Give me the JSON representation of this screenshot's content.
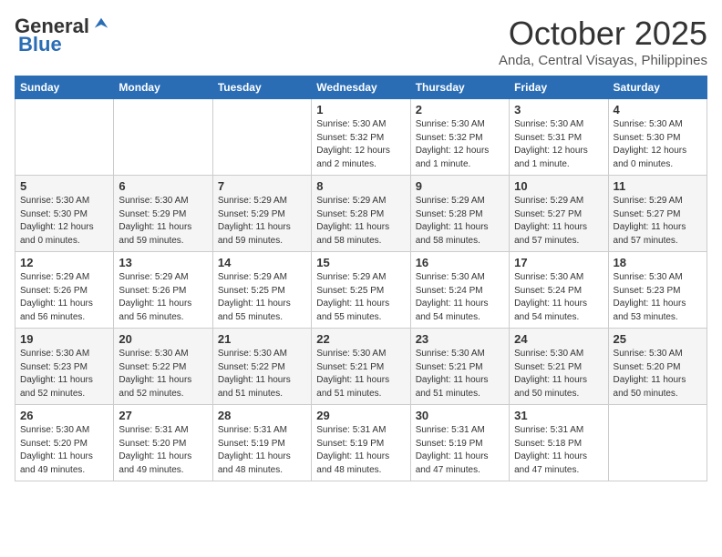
{
  "header": {
    "logo_general": "General",
    "logo_blue": "Blue",
    "month": "October 2025",
    "location": "Anda, Central Visayas, Philippines"
  },
  "days_of_week": [
    "Sunday",
    "Monday",
    "Tuesday",
    "Wednesday",
    "Thursday",
    "Friday",
    "Saturday"
  ],
  "weeks": [
    [
      {
        "day": "",
        "info": ""
      },
      {
        "day": "",
        "info": ""
      },
      {
        "day": "",
        "info": ""
      },
      {
        "day": "1",
        "info": "Sunrise: 5:30 AM\nSunset: 5:32 PM\nDaylight: 12 hours\nand 2 minutes."
      },
      {
        "day": "2",
        "info": "Sunrise: 5:30 AM\nSunset: 5:32 PM\nDaylight: 12 hours\nand 1 minute."
      },
      {
        "day": "3",
        "info": "Sunrise: 5:30 AM\nSunset: 5:31 PM\nDaylight: 12 hours\nand 1 minute."
      },
      {
        "day": "4",
        "info": "Sunrise: 5:30 AM\nSunset: 5:30 PM\nDaylight: 12 hours\nand 0 minutes."
      }
    ],
    [
      {
        "day": "5",
        "info": "Sunrise: 5:30 AM\nSunset: 5:30 PM\nDaylight: 12 hours\nand 0 minutes."
      },
      {
        "day": "6",
        "info": "Sunrise: 5:30 AM\nSunset: 5:29 PM\nDaylight: 11 hours\nand 59 minutes."
      },
      {
        "day": "7",
        "info": "Sunrise: 5:29 AM\nSunset: 5:29 PM\nDaylight: 11 hours\nand 59 minutes."
      },
      {
        "day": "8",
        "info": "Sunrise: 5:29 AM\nSunset: 5:28 PM\nDaylight: 11 hours\nand 58 minutes."
      },
      {
        "day": "9",
        "info": "Sunrise: 5:29 AM\nSunset: 5:28 PM\nDaylight: 11 hours\nand 58 minutes."
      },
      {
        "day": "10",
        "info": "Sunrise: 5:29 AM\nSunset: 5:27 PM\nDaylight: 11 hours\nand 57 minutes."
      },
      {
        "day": "11",
        "info": "Sunrise: 5:29 AM\nSunset: 5:27 PM\nDaylight: 11 hours\nand 57 minutes."
      }
    ],
    [
      {
        "day": "12",
        "info": "Sunrise: 5:29 AM\nSunset: 5:26 PM\nDaylight: 11 hours\nand 56 minutes."
      },
      {
        "day": "13",
        "info": "Sunrise: 5:29 AM\nSunset: 5:26 PM\nDaylight: 11 hours\nand 56 minutes."
      },
      {
        "day": "14",
        "info": "Sunrise: 5:29 AM\nSunset: 5:25 PM\nDaylight: 11 hours\nand 55 minutes."
      },
      {
        "day": "15",
        "info": "Sunrise: 5:29 AM\nSunset: 5:25 PM\nDaylight: 11 hours\nand 55 minutes."
      },
      {
        "day": "16",
        "info": "Sunrise: 5:30 AM\nSunset: 5:24 PM\nDaylight: 11 hours\nand 54 minutes."
      },
      {
        "day": "17",
        "info": "Sunrise: 5:30 AM\nSunset: 5:24 PM\nDaylight: 11 hours\nand 54 minutes."
      },
      {
        "day": "18",
        "info": "Sunrise: 5:30 AM\nSunset: 5:23 PM\nDaylight: 11 hours\nand 53 minutes."
      }
    ],
    [
      {
        "day": "19",
        "info": "Sunrise: 5:30 AM\nSunset: 5:23 PM\nDaylight: 11 hours\nand 52 minutes."
      },
      {
        "day": "20",
        "info": "Sunrise: 5:30 AM\nSunset: 5:22 PM\nDaylight: 11 hours\nand 52 minutes."
      },
      {
        "day": "21",
        "info": "Sunrise: 5:30 AM\nSunset: 5:22 PM\nDaylight: 11 hours\nand 51 minutes."
      },
      {
        "day": "22",
        "info": "Sunrise: 5:30 AM\nSunset: 5:21 PM\nDaylight: 11 hours\nand 51 minutes."
      },
      {
        "day": "23",
        "info": "Sunrise: 5:30 AM\nSunset: 5:21 PM\nDaylight: 11 hours\nand 51 minutes."
      },
      {
        "day": "24",
        "info": "Sunrise: 5:30 AM\nSunset: 5:21 PM\nDaylight: 11 hours\nand 50 minutes."
      },
      {
        "day": "25",
        "info": "Sunrise: 5:30 AM\nSunset: 5:20 PM\nDaylight: 11 hours\nand 50 minutes."
      }
    ],
    [
      {
        "day": "26",
        "info": "Sunrise: 5:30 AM\nSunset: 5:20 PM\nDaylight: 11 hours\nand 49 minutes."
      },
      {
        "day": "27",
        "info": "Sunrise: 5:31 AM\nSunset: 5:20 PM\nDaylight: 11 hours\nand 49 minutes."
      },
      {
        "day": "28",
        "info": "Sunrise: 5:31 AM\nSunset: 5:19 PM\nDaylight: 11 hours\nand 48 minutes."
      },
      {
        "day": "29",
        "info": "Sunrise: 5:31 AM\nSunset: 5:19 PM\nDaylight: 11 hours\nand 48 minutes."
      },
      {
        "day": "30",
        "info": "Sunrise: 5:31 AM\nSunset: 5:19 PM\nDaylight: 11 hours\nand 47 minutes."
      },
      {
        "day": "31",
        "info": "Sunrise: 5:31 AM\nSunset: 5:18 PM\nDaylight: 11 hours\nand 47 minutes."
      },
      {
        "day": "",
        "info": ""
      }
    ]
  ]
}
